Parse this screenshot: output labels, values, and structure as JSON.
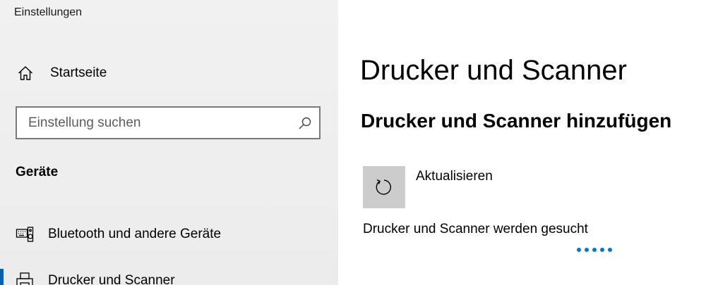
{
  "window": {
    "title": "Einstellungen"
  },
  "sidebar": {
    "home_label": "Startseite",
    "search": {
      "placeholder": "Einstellung suchen",
      "value": ""
    },
    "section_heading": "Geräte",
    "items": [
      {
        "label": "Bluetooth und andere Geräte",
        "icon": "keyboard-speaker-icon",
        "selected": false
      },
      {
        "label": "Drucker und Scanner",
        "icon": "printer-icon",
        "selected": true
      }
    ]
  },
  "main": {
    "title": "Drucker und Scanner",
    "section_title": "Drucker und Scanner hinzufügen",
    "refresh_label": "Aktualisieren",
    "status_text": "Drucker und Scanner werden gesucht"
  },
  "colors": {
    "accent": "#0078d7",
    "selection_indicator": "#0063b1",
    "tile": "#cccccc"
  }
}
